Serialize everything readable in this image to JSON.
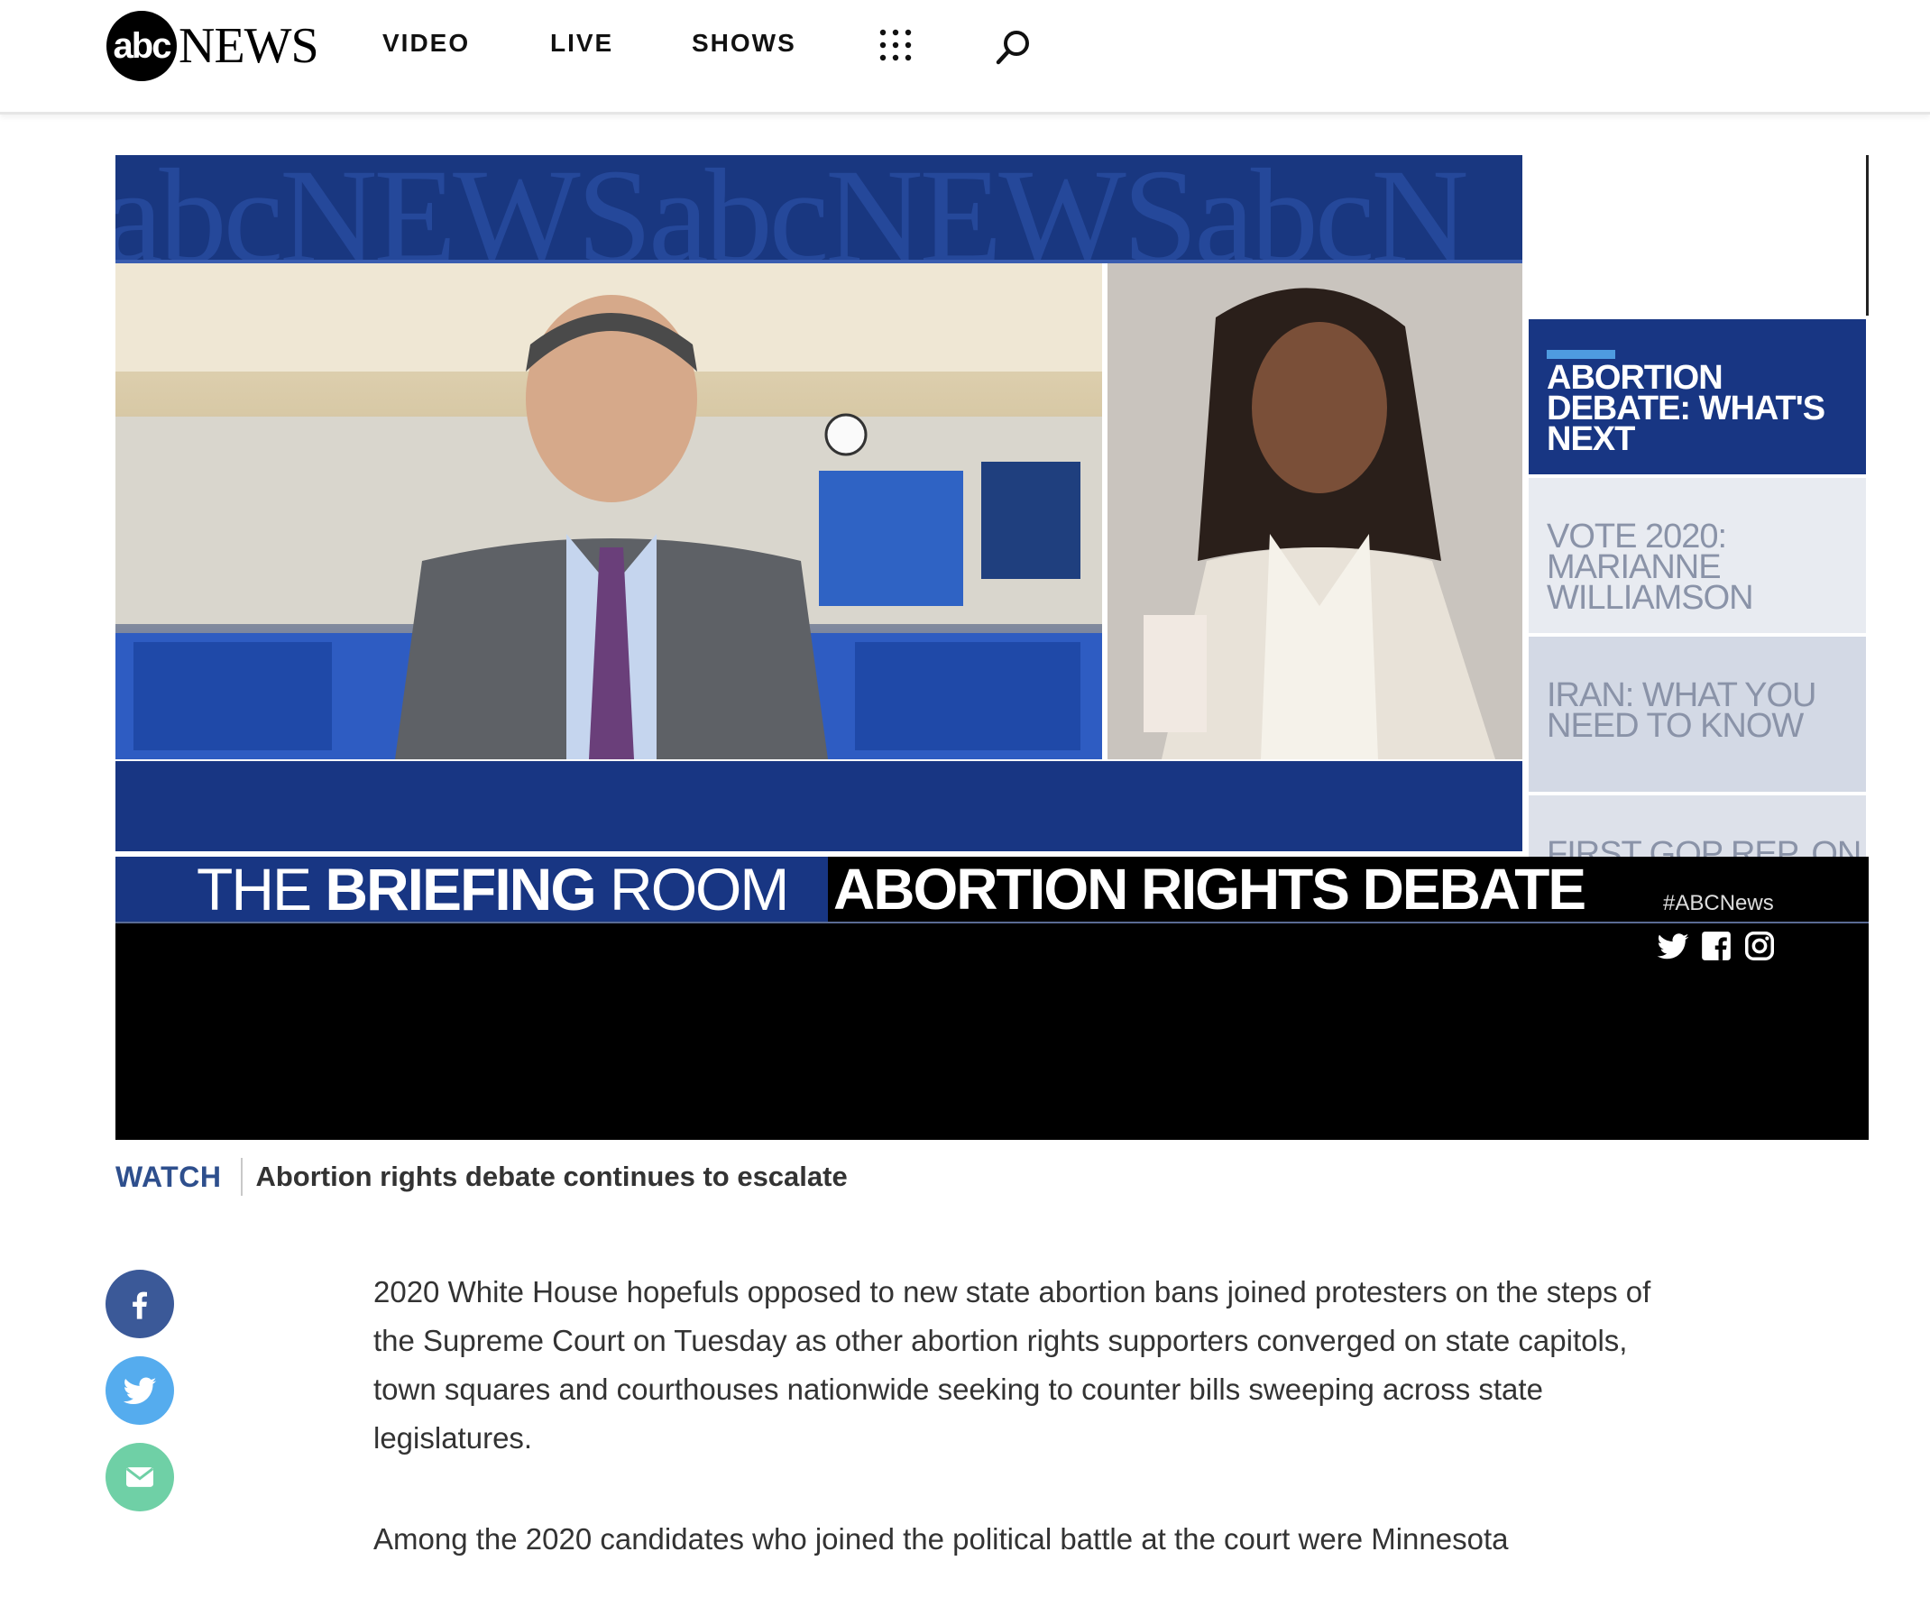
{
  "header": {
    "logo": {
      "circle": "abc",
      "word": "NEWS"
    },
    "nav": [
      {
        "label": "VIDEO"
      },
      {
        "label": "LIVE"
      },
      {
        "label": "SHOWS"
      }
    ],
    "icons": [
      "grid-menu-icon",
      "search-icon"
    ]
  },
  "player": {
    "banner_text": "abcNEWSabcNEWSabcN",
    "playlist": [
      {
        "label": "ABORTION DEBATE: WHAT'S NEXT",
        "active": true
      },
      {
        "label": "VOTE 2020: MARIANNE WILLIAMSON"
      },
      {
        "label": "IRAN: WHAT YOU NEED TO KNOW"
      },
      {
        "label": "FIRST GOP REP. ON TRUMP IMPEACHMENT"
      }
    ],
    "lower_third": {
      "show_pre": "THE ",
      "show_bold": "BRIEFING",
      "show_post": " ROOM",
      "topic": "ABORTION RIGHTS DEBATE",
      "hashtag": "#ABCNews"
    },
    "social_icons": [
      "twitter-icon",
      "facebook-icon",
      "instagram-icon"
    ],
    "colors": {
      "navy": "#183683",
      "accent": "#4e9be0"
    }
  },
  "caption": {
    "watch": "WATCH",
    "title": "Abortion rights debate continues to escalate"
  },
  "share": [
    {
      "icon": "facebook-icon",
      "color": "#3b5998"
    },
    {
      "icon": "twitter-icon",
      "color": "#55acee"
    },
    {
      "icon": "email-icon",
      "color": "#6fd0a6"
    }
  ],
  "article": {
    "paragraphs": [
      "2020 White House hopefuls opposed to new state abortion bans joined protesters on the steps of the Supreme Court on Tuesday as other abortion rights supporters converged on state capitols, town squares and courthouses nationwide seeking to counter bills sweeping across state legislatures.",
      "Among the 2020 candidates who joined the political battle at the court were Minnesota"
    ]
  }
}
